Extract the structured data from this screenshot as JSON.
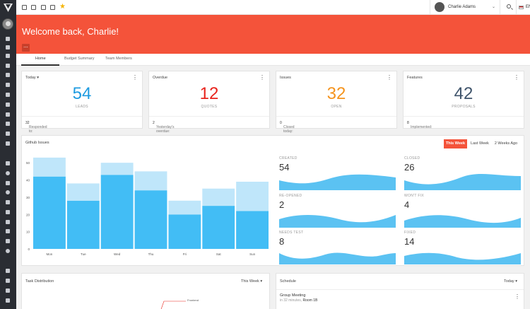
{
  "header": {
    "welcome": "Welcome back, Charlie!",
    "more_label": "..."
  },
  "topbar": {
    "user_name": "Charlie Adams",
    "language": "EN"
  },
  "tabs": [
    {
      "label": "Home",
      "active": true
    },
    {
      "label": "Budget Summary",
      "active": false
    },
    {
      "label": "Team Members",
      "active": false
    }
  ],
  "kpis": [
    {
      "title": "Today",
      "value": "54",
      "label": "LEADS",
      "footer_label": "Responded to:",
      "footer_value": "32",
      "color": "#1e9be0"
    },
    {
      "title": "Overdue",
      "value": "12",
      "label": "QUOTES",
      "footer_label": "Yesterday's overdue:",
      "footer_value": "2",
      "color": "#e8241d"
    },
    {
      "title": "Issues",
      "value": "32",
      "label": "OPEN",
      "footer_label": "Closed today:",
      "footer_value": "0",
      "color": "#f5941e"
    },
    {
      "title": "Features",
      "value": "42",
      "label": "PROPOSALS",
      "footer_label": "Implemented:",
      "footer_value": "8",
      "color": "#40556c"
    }
  ],
  "github": {
    "title": "Github Issues",
    "ranges": [
      "This Week",
      "Last Week",
      "2 Weeks Ago"
    ],
    "active_range": "This Week",
    "stats": [
      {
        "label": "CREATED",
        "value": "54"
      },
      {
        "label": "CLOSED",
        "value": "26"
      },
      {
        "label": "RE-OPENED",
        "value": "2"
      },
      {
        "label": "WON'T FIX",
        "value": "4"
      },
      {
        "label": "NEEDS TEST",
        "value": "8"
      },
      {
        "label": "FIXED",
        "value": "14"
      }
    ]
  },
  "chart_data": {
    "type": "bar",
    "stacked": true,
    "categories": [
      "Mon",
      "Tue",
      "Wed",
      "Thu",
      "Fri",
      "Sat",
      "Sun"
    ],
    "series": [
      {
        "values": [
          42,
          28,
          43,
          34,
          20,
          25,
          22
        ],
        "color": "#42bdf5"
      },
      {
        "values": [
          11,
          10,
          7,
          11,
          8,
          10,
          17
        ],
        "color": "#bfe6fa"
      }
    ],
    "yticks": [
      0,
      10,
      20,
      30,
      40,
      50
    ],
    "ylim": [
      0,
      55
    ],
    "grid": false,
    "title": ""
  },
  "task_distribution": {
    "title": "Task Distribution",
    "range": "This Week",
    "annotation": "Frontend"
  },
  "schedule": {
    "title": "Schedule",
    "range": "Today",
    "event_title": "Group Meeting",
    "event_time": "in 32 minutes",
    "event_room": "Room 1B"
  },
  "colors": {
    "accent": "#f4533a",
    "sidebar": "#2a2d33",
    "bar_primary": "#42bdf5",
    "bar_secondary": "#bfe6fa"
  }
}
